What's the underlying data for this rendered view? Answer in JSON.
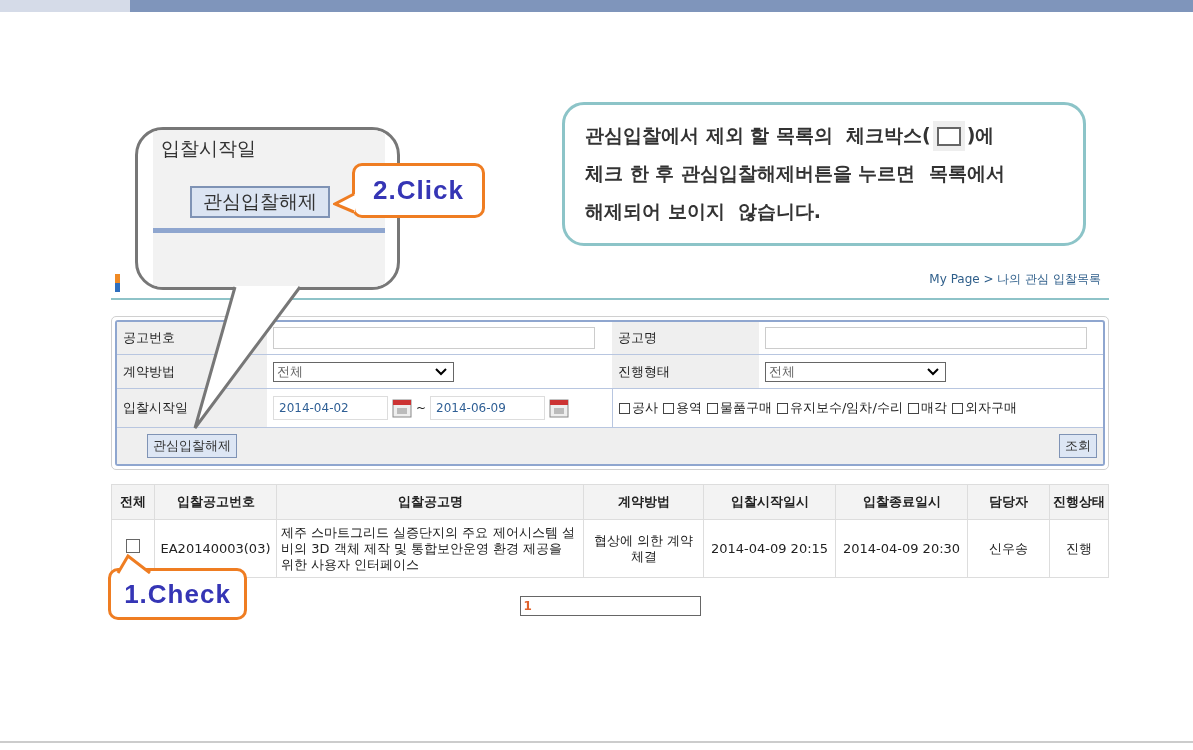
{
  "instruction_callout": {
    "line_1_start": "관심입찰에서 제외 할 목록의  체크박스(",
    "line_1_end": ")에",
    "lines": [
      "체크 한 후 관심입찰해제버튼을 누르면  목록에서",
      "해제되어 보이지  않습니다."
    ]
  },
  "zoom_callout": {
    "label": "입찰시작일",
    "button": "관심입찰해제"
  },
  "click_callout": {
    "text": "2.Click"
  },
  "check_callout": {
    "text": "1.Check"
  },
  "breadcrumb": "My Page > 나의 관심 입찰목록",
  "search_form": {
    "rows": [
      [
        {
          "label": "공고번호",
          "kind": "text"
        },
        {
          "label": "공고명",
          "kind": "text"
        }
      ],
      [
        {
          "label": "계약방법",
          "kind": "select",
          "value": "전체"
        },
        {
          "label": "진행형태",
          "kind": "select",
          "value": "전체"
        }
      ],
      [
        {
          "label": "입찰시작일",
          "kind": "date_range",
          "from": "2014-04-02",
          "separator": "~",
          "to": "2014-06-09"
        },
        {
          "kind": "checkboxes",
          "options": [
            {
              "label": "공사",
              "checked": false
            },
            {
              "label": "용역",
              "checked": false
            },
            {
              "label": "물품구매",
              "checked": false
            },
            {
              "label": "유지보수/임차/수리",
              "checked": false
            },
            {
              "label": "매각",
              "checked": false
            },
            {
              "label": "외자구매",
              "checked": false
            }
          ]
        }
      ]
    ],
    "left_button": "관심입찰해제",
    "right_button": "조회"
  },
  "table": {
    "columns": [
      "전체",
      "입찰공고번호",
      "입찰공고명",
      "계약방법",
      "입찰시작일시",
      "입찰종료일시",
      "담당자",
      "진행상태"
    ],
    "rows": [
      {
        "cells": [
          {
            "kind": "checkbox",
            "checked": false
          },
          {
            "kind": "text",
            "text": "EA20140003(03)"
          },
          {
            "kind": "text",
            "text": "제주 스마트그리드 실증단지의 주요 제어시스템 설비의 3D 객체 제작 및 통합보안운영 환경 제공을 위한 사용자 인터페이스"
          },
          {
            "kind": "text",
            "text": "협상에 의한 계약체결"
          },
          {
            "kind": "text",
            "text": "2014-04-09 20:15"
          },
          {
            "kind": "text",
            "text": "2014-04-09 20:30"
          },
          {
            "kind": "text",
            "text": "신우송"
          },
          {
            "kind": "text",
            "text": "진행"
          }
        ]
      }
    ]
  },
  "pagination": [
    {
      "label": "1",
      "selected": true
    }
  ]
}
